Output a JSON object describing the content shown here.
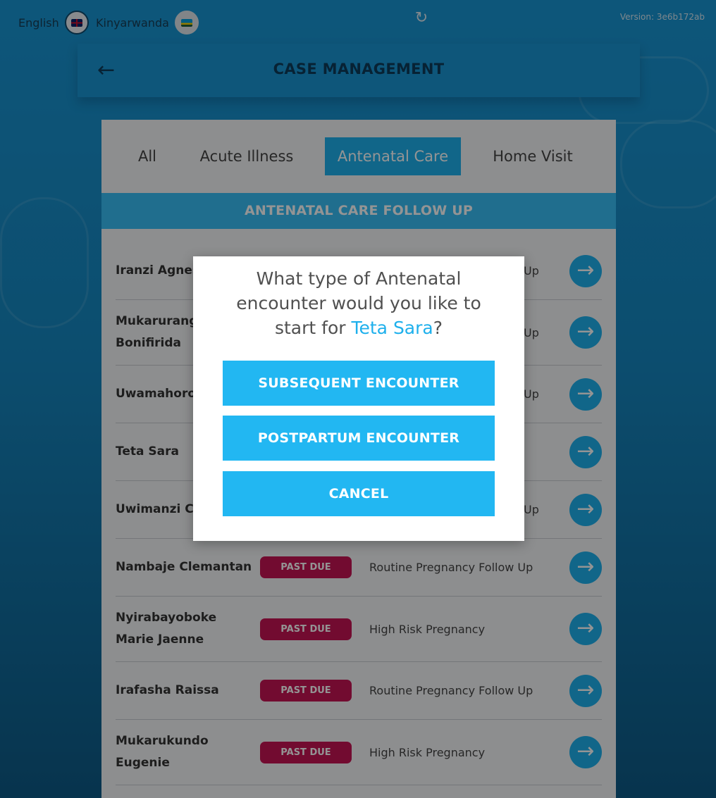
{
  "topbar": {
    "languages": [
      {
        "label": "English",
        "flag": "uk-flag-icon"
      },
      {
        "label": "Kinyarwanda",
        "flag": "rwanda-flag-icon"
      }
    ],
    "version": "Version: 3e6b172ab"
  },
  "header": {
    "title": "CASE MANAGEMENT"
  },
  "tabs": [
    {
      "label": "All",
      "active": false
    },
    {
      "label": "Acute Illness",
      "active": false
    },
    {
      "label": "Antenatal Care",
      "active": true
    },
    {
      "label": "Home Visit",
      "active": false
    }
  ],
  "section_title": "ANTENATAL CARE FOLLOW UP",
  "rows": [
    {
      "name": "Iranzi Agnes",
      "badge": "",
      "type": "Up"
    },
    {
      "name": "Mukarurangwa Bonifirida",
      "badge": "",
      "type": "Up"
    },
    {
      "name": "Uwamahoro",
      "badge": "",
      "type": "Up"
    },
    {
      "name": "Teta Sara",
      "badge": "",
      "type": ""
    },
    {
      "name": "Uwimanzi C",
      "badge": "",
      "type": "Up"
    },
    {
      "name": "Nambaje Clemantan",
      "badge": "PAST DUE",
      "type": "Routine Pregnancy Follow Up"
    },
    {
      "name": "Nyirabayoboke Marie Jaenne",
      "badge": "PAST DUE",
      "type": "High Risk Pregnancy"
    },
    {
      "name": "Irafasha Raissa",
      "badge": "PAST DUE",
      "type": "Routine Pregnancy Follow Up"
    },
    {
      "name": "Mukarukundo Eugenie",
      "badge": "PAST DUE",
      "type": "High Risk Pregnancy"
    }
  ],
  "modal": {
    "question_prefix": "What type of Antenatal encounter would you like to start for ",
    "patient_name": "Teta Sara",
    "question_suffix": "?",
    "buttons": {
      "subsequent": "SUBSEQUENT ENCOUNTER",
      "postpartum": "POSTPARTUM ENCOUNTER",
      "cancel": "CANCEL"
    }
  },
  "colors": {
    "accent": "#1eb0ec",
    "past_due": "#c41453",
    "background": "#1895d3"
  }
}
